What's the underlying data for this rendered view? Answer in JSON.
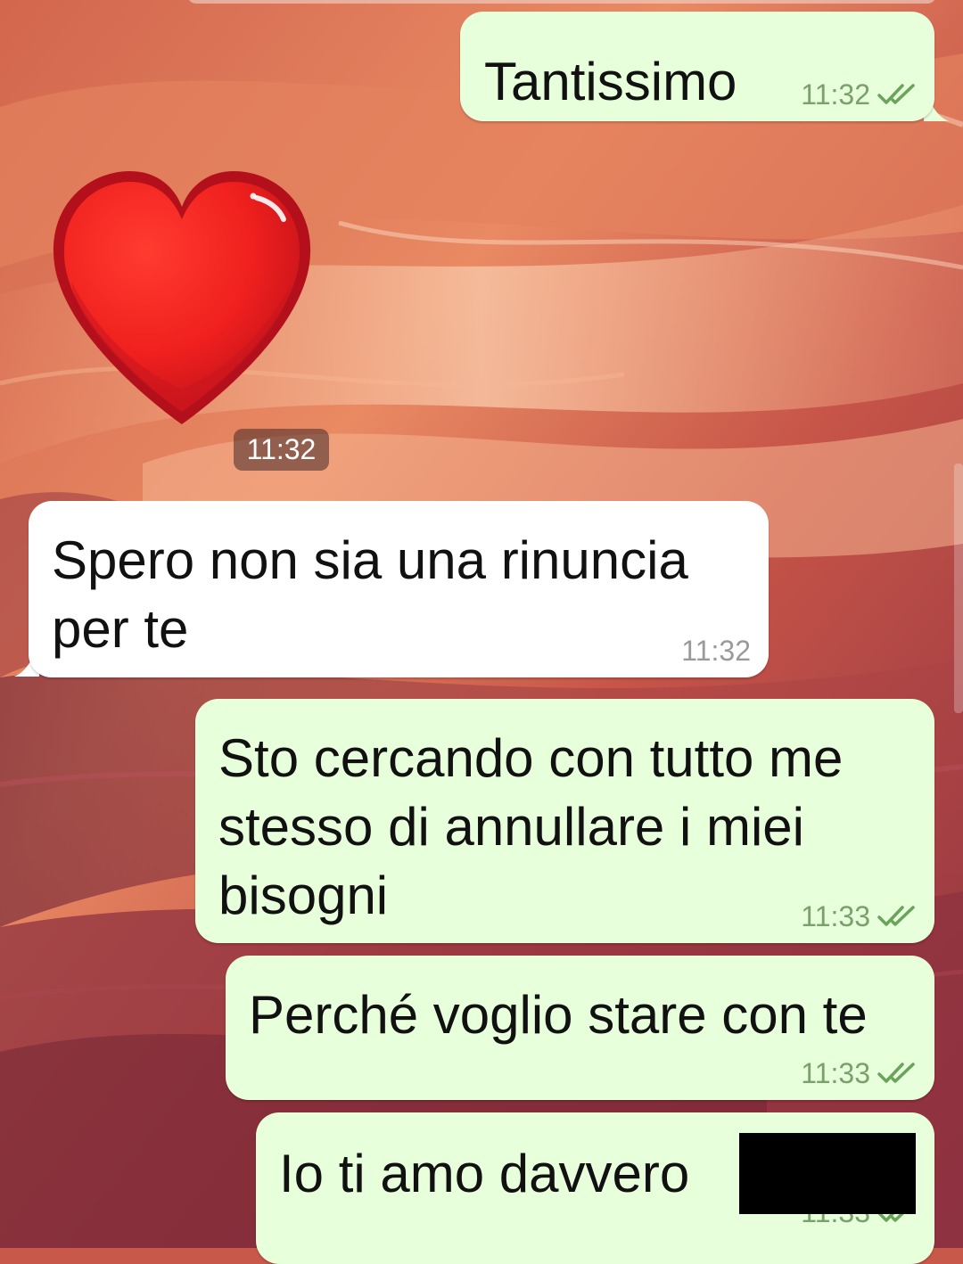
{
  "chat": {
    "messages": [
      {
        "direction": "outgoing",
        "type": "text",
        "text": "Tantissimo",
        "time": "11:32",
        "status_icon": "double-check-icon"
      },
      {
        "direction": "incoming",
        "type": "sticker",
        "sticker_icon": "red-heart-icon",
        "time": "11:32"
      },
      {
        "direction": "incoming",
        "type": "text",
        "text": "Spero non sia una rinuncia\nper te",
        "time": "11:32"
      },
      {
        "direction": "outgoing",
        "type": "text",
        "text": "Sto cercando con tutto me\nstesso di annullare i miei\nbisogni",
        "time": "11:33",
        "status_icon": "double-check-icon"
      },
      {
        "direction": "outgoing",
        "type": "text",
        "text": "Perché voglio stare con te",
        "time": "11:33",
        "status_icon": "double-check-icon"
      },
      {
        "direction": "outgoing",
        "type": "text",
        "text": "Io ti amo davvero",
        "time": "11:33",
        "status_icon": "double-check-icon",
        "redacted_suffix": true
      }
    ]
  },
  "colors": {
    "outgoing_bubble": "#e7ffdb",
    "incoming_bubble": "#ffffff",
    "outgoing_meta": "#7aa06c",
    "incoming_meta": "#9a9a9a",
    "read_tick": "#6aa35a",
    "heart": "#e0191b"
  },
  "wallpaper": "antelope-canyon-sandstone"
}
